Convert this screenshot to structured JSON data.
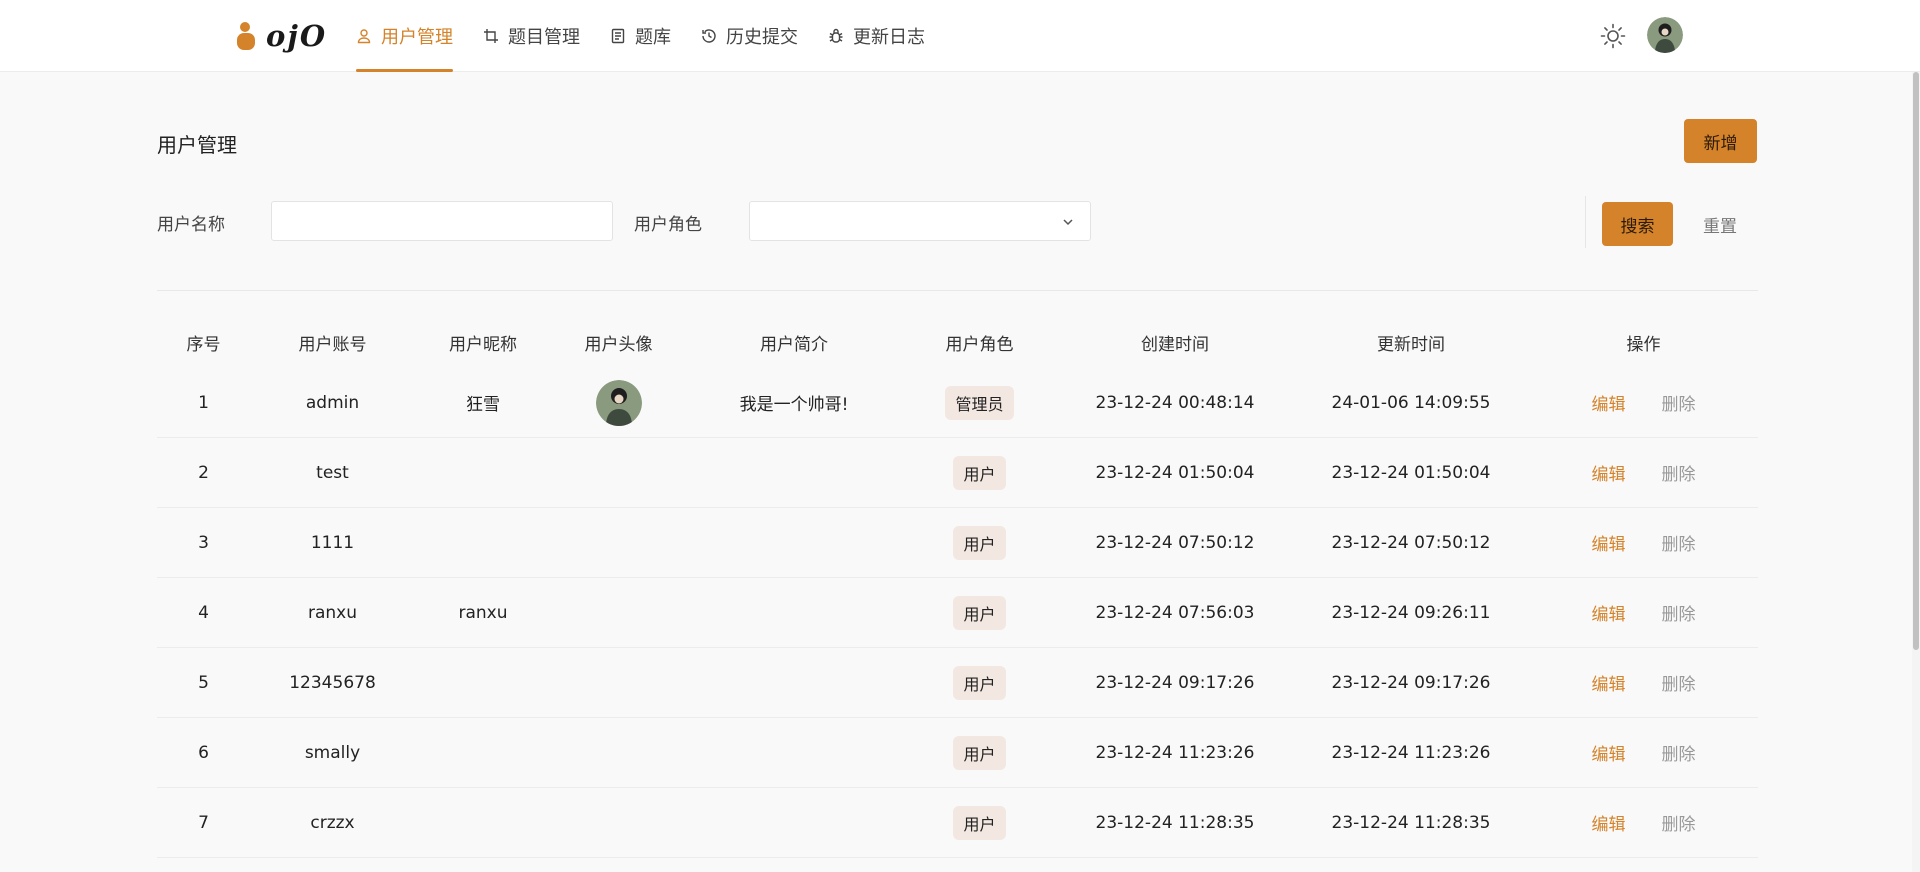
{
  "brand": {
    "name": "ojO",
    "accent": "#d4832a"
  },
  "nav": {
    "items": [
      {
        "label": "用户管理",
        "icon": "user-icon",
        "active": true
      },
      {
        "label": "题目管理",
        "icon": "crop-icon",
        "active": false
      },
      {
        "label": "题库",
        "icon": "document-icon",
        "active": false
      },
      {
        "label": "历史提交",
        "icon": "history-icon",
        "active": false
      },
      {
        "label": "更新日志",
        "icon": "bug-icon",
        "active": false
      }
    ]
  },
  "page": {
    "title": "用户管理",
    "add_label": "新增"
  },
  "filters": {
    "username_label": "用户名称",
    "username_value": "",
    "role_label": "用户角色",
    "role_value": "",
    "search_label": "搜索",
    "reset_label": "重置"
  },
  "table": {
    "columns": [
      "序号",
      "用户账号",
      "用户昵称",
      "用户头像",
      "用户简介",
      "用户角色",
      "创建时间",
      "更新时间",
      "操作"
    ],
    "edit_label": "编辑",
    "delete_label": "删除",
    "rows": [
      {
        "index": "1",
        "account": "admin",
        "nickname": "狂雪",
        "has_avatar": true,
        "bio": "我是一个帅哥!",
        "role": "管理员",
        "created": "23-12-24 00:48:14",
        "updated": "24-01-06 14:09:55"
      },
      {
        "index": "2",
        "account": "test",
        "nickname": "",
        "has_avatar": false,
        "bio": "",
        "role": "用户",
        "created": "23-12-24 01:50:04",
        "updated": "23-12-24 01:50:04"
      },
      {
        "index": "3",
        "account": "1111",
        "nickname": "",
        "has_avatar": false,
        "bio": "",
        "role": "用户",
        "created": "23-12-24 07:50:12",
        "updated": "23-12-24 07:50:12"
      },
      {
        "index": "4",
        "account": "ranxu",
        "nickname": "ranxu",
        "has_avatar": false,
        "bio": "",
        "role": "用户",
        "created": "23-12-24 07:56:03",
        "updated": "23-12-24 09:26:11"
      },
      {
        "index": "5",
        "account": "12345678",
        "nickname": "",
        "has_avatar": false,
        "bio": "",
        "role": "用户",
        "created": "23-12-24 09:17:26",
        "updated": "23-12-24 09:17:26"
      },
      {
        "index": "6",
        "account": "smally",
        "nickname": "",
        "has_avatar": false,
        "bio": "",
        "role": "用户",
        "created": "23-12-24 11:23:26",
        "updated": "23-12-24 11:23:26"
      },
      {
        "index": "7",
        "account": "crzzx",
        "nickname": "",
        "has_avatar": false,
        "bio": "",
        "role": "用户",
        "created": "23-12-24 11:28:35",
        "updated": "23-12-24 11:28:35"
      }
    ]
  }
}
